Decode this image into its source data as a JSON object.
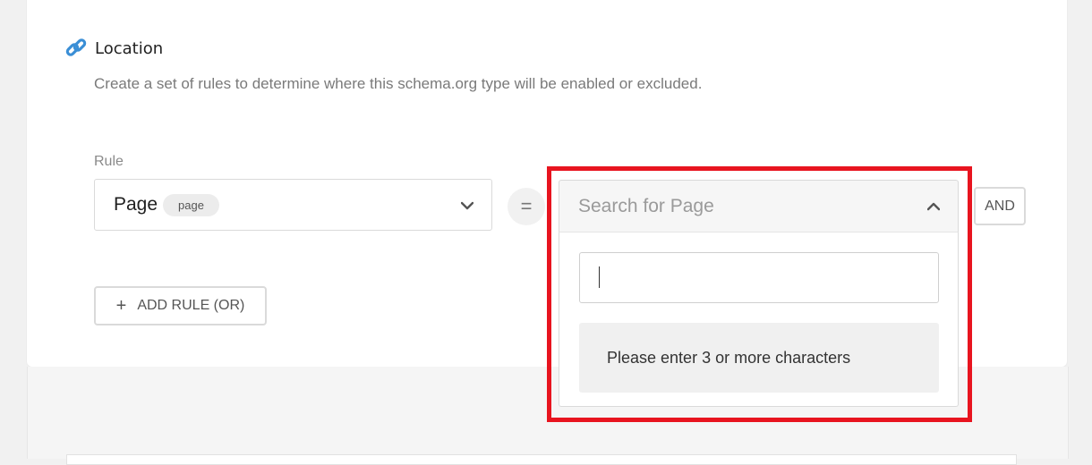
{
  "section": {
    "title": "Location",
    "icon": "link-icon",
    "description": "Create a set of rules to determine where this schema.org type will be enabled or excluded."
  },
  "rule": {
    "label": "Rule",
    "selected_value": "Page",
    "selected_badge": "page",
    "operator": "=",
    "search_placeholder": "Search for Page",
    "search_input_value": "",
    "dropdown_message": "Please enter 3 or more characters",
    "and_label": "AND",
    "add_rule_label": "ADD RULE (OR)"
  },
  "colors": {
    "highlight": "#e8141f",
    "link_icon": "#3b8fd6"
  }
}
